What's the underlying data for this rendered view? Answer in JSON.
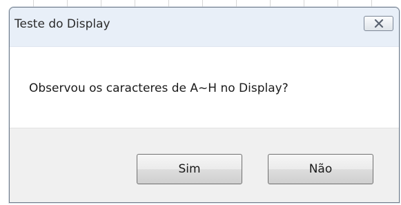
{
  "window": {
    "title": "Teste do Display",
    "close_icon": "close-icon"
  },
  "dialog": {
    "message": "Observou os caracteres de A~H no Display?"
  },
  "buttons": {
    "yes_label": "Sim",
    "no_label": "Não"
  },
  "colors": {
    "titlebar": "#e8eff8",
    "footer": "#f0f0f0",
    "border": "#6e7a89"
  }
}
